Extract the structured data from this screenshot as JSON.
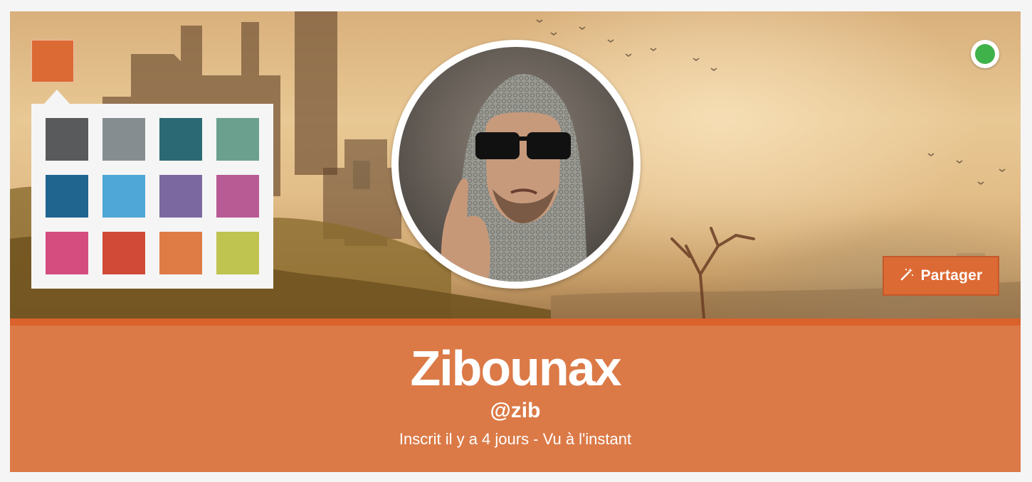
{
  "theme": {
    "accent": "#dc6a34",
    "accent_dark": "#d9622d",
    "info_bg": "#db7a47"
  },
  "color_picker": {
    "selected_color": "#dc6a34",
    "swatches": [
      "#595a5c",
      "#868d91",
      "#2b6a74",
      "#6ba08f",
      "#206590",
      "#4ea7d6",
      "#7c68a0",
      "#b85a94",
      "#d44d7e",
      "#d04a37",
      "#df7b45",
      "#bfc34f"
    ]
  },
  "profile": {
    "display_name": "Zibounax",
    "handle": "@zib",
    "meta": "Inscrit il y a 4 jours - Vu à l'instant",
    "online": true
  },
  "actions": {
    "share_label": "Partager",
    "share_icon": "magic-wand-icon"
  }
}
